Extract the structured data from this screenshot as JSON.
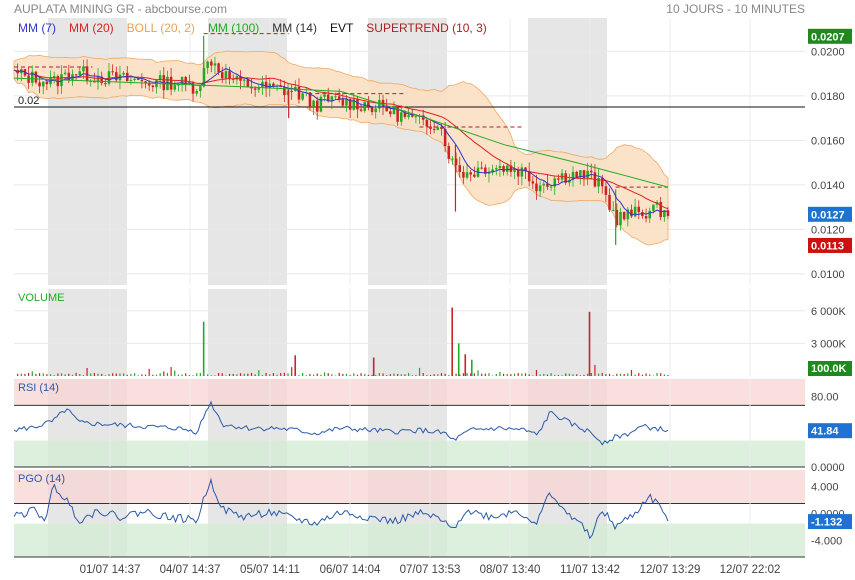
{
  "header": {
    "title": "AUPLATA MINING GR - abcbourse.com",
    "period": "10 JOURS - 10 MINUTES"
  },
  "legend": [
    {
      "label": "MM (7)",
      "color": "#3333cc"
    },
    {
      "label": "MM (20)",
      "color": "#dd2222"
    },
    {
      "label": "BOLL (20, 2)",
      "color": "#f0a050"
    },
    {
      "label": "MM (100)",
      "color": "#22aa22"
    },
    {
      "label": "MM (14)",
      "color": "#333333"
    },
    {
      "label": "EVT",
      "color": "#111111"
    },
    {
      "label": "SUPERTREND (10, 3)",
      "color": "#aa2222"
    }
  ],
  "colors": {
    "up": "#22aa22",
    "down": "#cc2222",
    "boll_fill": "#fbe0c4",
    "boll_line": "#f0a050",
    "mm7": "#3333cc",
    "mm20": "#dd2222",
    "mm100": "#22aa22",
    "supertrend": "#aa2222",
    "rsi_line": "#2a5aa8",
    "zone_high": "#f8d4d4",
    "zone_low": "#d4ebd4",
    "session_shade": "#e6e6e6",
    "badge_current": "#1e73d2",
    "badge_high": "#1e8a1e",
    "badge_low": "#cc1111",
    "badge_volume": "#1e8a1e"
  },
  "chart_data": [
    {
      "type": "candlestick",
      "name": "price",
      "ylim": [
        0.0095,
        0.0215
      ],
      "yticks": [
        "0.0200",
        "0.0180",
        "0.0160",
        "0.0140",
        "0.0120",
        "0.0100"
      ],
      "ytick_values": [
        0.02,
        0.018,
        0.016,
        0.014,
        0.012,
        0.01
      ],
      "horizontal_line": {
        "value": 0.0175,
        "label": "0.02"
      },
      "badges": [
        {
          "label": "0.0207",
          "value": 0.0207,
          "kind": "high"
        },
        {
          "label": "0.0127",
          "value": 0.0127,
          "kind": "current"
        },
        {
          "label": "0.0113",
          "value": 0.0113,
          "kind": "low"
        }
      ],
      "mm100_points": [
        [
          0,
          0.0188
        ],
        [
          0.36,
          0.0184
        ],
        [
          0.5,
          0.0182
        ],
        [
          0.62,
          0.0171
        ],
        [
          0.75,
          0.0158
        ],
        [
          0.86,
          0.015
        ],
        [
          1.0,
          0.0139
        ]
      ],
      "anchors": [
        [
          0.0,
          0.019
        ],
        [
          0.03,
          0.0188
        ],
        [
          0.06,
          0.0186
        ],
        [
          0.09,
          0.0191
        ],
        [
          0.12,
          0.0189
        ],
        [
          0.15,
          0.0188
        ],
        [
          0.18,
          0.0187
        ],
        [
          0.21,
          0.0186
        ],
        [
          0.25,
          0.0186
        ],
        [
          0.28,
          0.0184
        ],
        [
          0.3,
          0.0197
        ],
        [
          0.32,
          0.019
        ],
        [
          0.34,
          0.0186
        ],
        [
          0.37,
          0.0184
        ],
        [
          0.4,
          0.0183
        ],
        [
          0.43,
          0.0182
        ],
        [
          0.46,
          0.0176
        ],
        [
          0.48,
          0.0178
        ],
        [
          0.51,
          0.0177
        ],
        [
          0.54,
          0.0176
        ],
        [
          0.57,
          0.0174
        ],
        [
          0.6,
          0.017
        ],
        [
          0.62,
          0.0168
        ],
        [
          0.65,
          0.0168
        ],
        [
          0.67,
          0.015
        ],
        [
          0.69,
          0.0145
        ],
        [
          0.72,
          0.0148
        ],
        [
          0.75,
          0.0148
        ],
        [
          0.78,
          0.0146
        ],
        [
          0.8,
          0.014
        ],
        [
          0.82,
          0.0142
        ],
        [
          0.85,
          0.0145
        ],
        [
          0.88,
          0.0144
        ],
        [
          0.9,
          0.0138
        ],
        [
          0.92,
          0.0125
        ],
        [
          0.95,
          0.0127
        ],
        [
          0.98,
          0.0129
        ],
        [
          1.0,
          0.0128
        ]
      ]
    },
    {
      "type": "bar",
      "name": "volume",
      "title": "VOLUME",
      "ylim": [
        0,
        8000
      ],
      "yticks": [
        "6 000K",
        "3 000K"
      ],
      "ytick_values": [
        6000,
        3000
      ],
      "badge": {
        "label": "100.0K",
        "value": 100
      },
      "spikes": [
        [
          0.29,
          5000,
          "up"
        ],
        [
          0.67,
          6300,
          "down"
        ],
        [
          0.88,
          5900,
          "down"
        ],
        [
          0.68,
          3000,
          "up"
        ],
        [
          0.43,
          1900,
          "down"
        ],
        [
          0.55,
          1700,
          "down"
        ],
        [
          0.69,
          2000,
          "down"
        ],
        [
          0.7,
          1500,
          "up"
        ]
      ]
    },
    {
      "type": "line",
      "name": "rsi",
      "title": "RSI (14)",
      "ylim": [
        0,
        100
      ],
      "yticks": [
        "80.00",
        "0.0000"
      ],
      "ytick_values": [
        80,
        0
      ],
      "zones": {
        "high": [
          70,
          100
        ],
        "low": [
          0,
          30
        ]
      },
      "badge": {
        "label": "41.84",
        "value": 41.84
      },
      "anchors": [
        [
          0.0,
          42
        ],
        [
          0.03,
          45
        ],
        [
          0.06,
          52
        ],
        [
          0.08,
          66
        ],
        [
          0.1,
          50
        ],
        [
          0.15,
          48
        ],
        [
          0.2,
          46
        ],
        [
          0.25,
          44
        ],
        [
          0.28,
          40
        ],
        [
          0.3,
          74
        ],
        [
          0.32,
          48
        ],
        [
          0.36,
          44
        ],
        [
          0.4,
          44
        ],
        [
          0.43,
          42
        ],
        [
          0.46,
          38
        ],
        [
          0.5,
          44
        ],
        [
          0.54,
          42
        ],
        [
          0.58,
          40
        ],
        [
          0.62,
          42
        ],
        [
          0.66,
          38
        ],
        [
          0.67,
          30
        ],
        [
          0.7,
          42
        ],
        [
          0.74,
          44
        ],
        [
          0.78,
          42
        ],
        [
          0.8,
          36
        ],
        [
          0.82,
          62
        ],
        [
          0.86,
          46
        ],
        [
          0.88,
          40
        ],
        [
          0.9,
          28
        ],
        [
          0.92,
          34
        ],
        [
          0.94,
          38
        ],
        [
          0.96,
          46
        ],
        [
          0.98,
          44
        ],
        [
          1.0,
          41.84
        ]
      ]
    },
    {
      "type": "line",
      "name": "pgo",
      "title": "PGO (14)",
      "ylim": [
        -6.5,
        6.5
      ],
      "yticks": [
        "4.000",
        "0.0000",
        "-4.000"
      ],
      "ytick_values": [
        4,
        0,
        -4
      ],
      "zones": {
        "high": [
          1.5,
          6.5
        ],
        "low": [
          -6.5,
          -1.5
        ]
      },
      "badge": {
        "label": "-1.132",
        "value": -1.132
      },
      "anchors": [
        [
          0.0,
          -0.5
        ],
        [
          0.03,
          0.5
        ],
        [
          0.05,
          -0.8
        ],
        [
          0.06,
          4.2
        ],
        [
          0.08,
          2.0
        ],
        [
          0.1,
          -1.0
        ],
        [
          0.13,
          0.5
        ],
        [
          0.16,
          -0.5
        ],
        [
          0.2,
          0.3
        ],
        [
          0.24,
          -0.6
        ],
        [
          0.28,
          -1.0
        ],
        [
          0.3,
          5.0
        ],
        [
          0.32,
          0.6
        ],
        [
          0.35,
          -0.5
        ],
        [
          0.39,
          0.2
        ],
        [
          0.43,
          -0.8
        ],
        [
          0.46,
          -1.5
        ],
        [
          0.5,
          0.2
        ],
        [
          0.54,
          -0.5
        ],
        [
          0.58,
          -1.2
        ],
        [
          0.62,
          0.0
        ],
        [
          0.65,
          -0.8
        ],
        [
          0.67,
          -2.5
        ],
        [
          0.69,
          0.5
        ],
        [
          0.73,
          -0.5
        ],
        [
          0.77,
          0.4
        ],
        [
          0.8,
          -1.5
        ],
        [
          0.82,
          3.4
        ],
        [
          0.84,
          0.3
        ],
        [
          0.86,
          -0.8
        ],
        [
          0.88,
          -3.5
        ],
        [
          0.9,
          0.4
        ],
        [
          0.92,
          -2.0
        ],
        [
          0.95,
          0.0
        ],
        [
          0.97,
          2.6
        ],
        [
          0.99,
          1.0
        ],
        [
          1.0,
          -1.132
        ]
      ]
    }
  ],
  "xaxis": {
    "labels": [
      "01/07 14:37",
      "04/07 14:37",
      "05/07 14:11",
      "06/07 14:04",
      "07/07 13:53",
      "08/07 13:40",
      "11/07 13:42",
      "12/07 13:29",
      "12/07 22:02"
    ]
  }
}
